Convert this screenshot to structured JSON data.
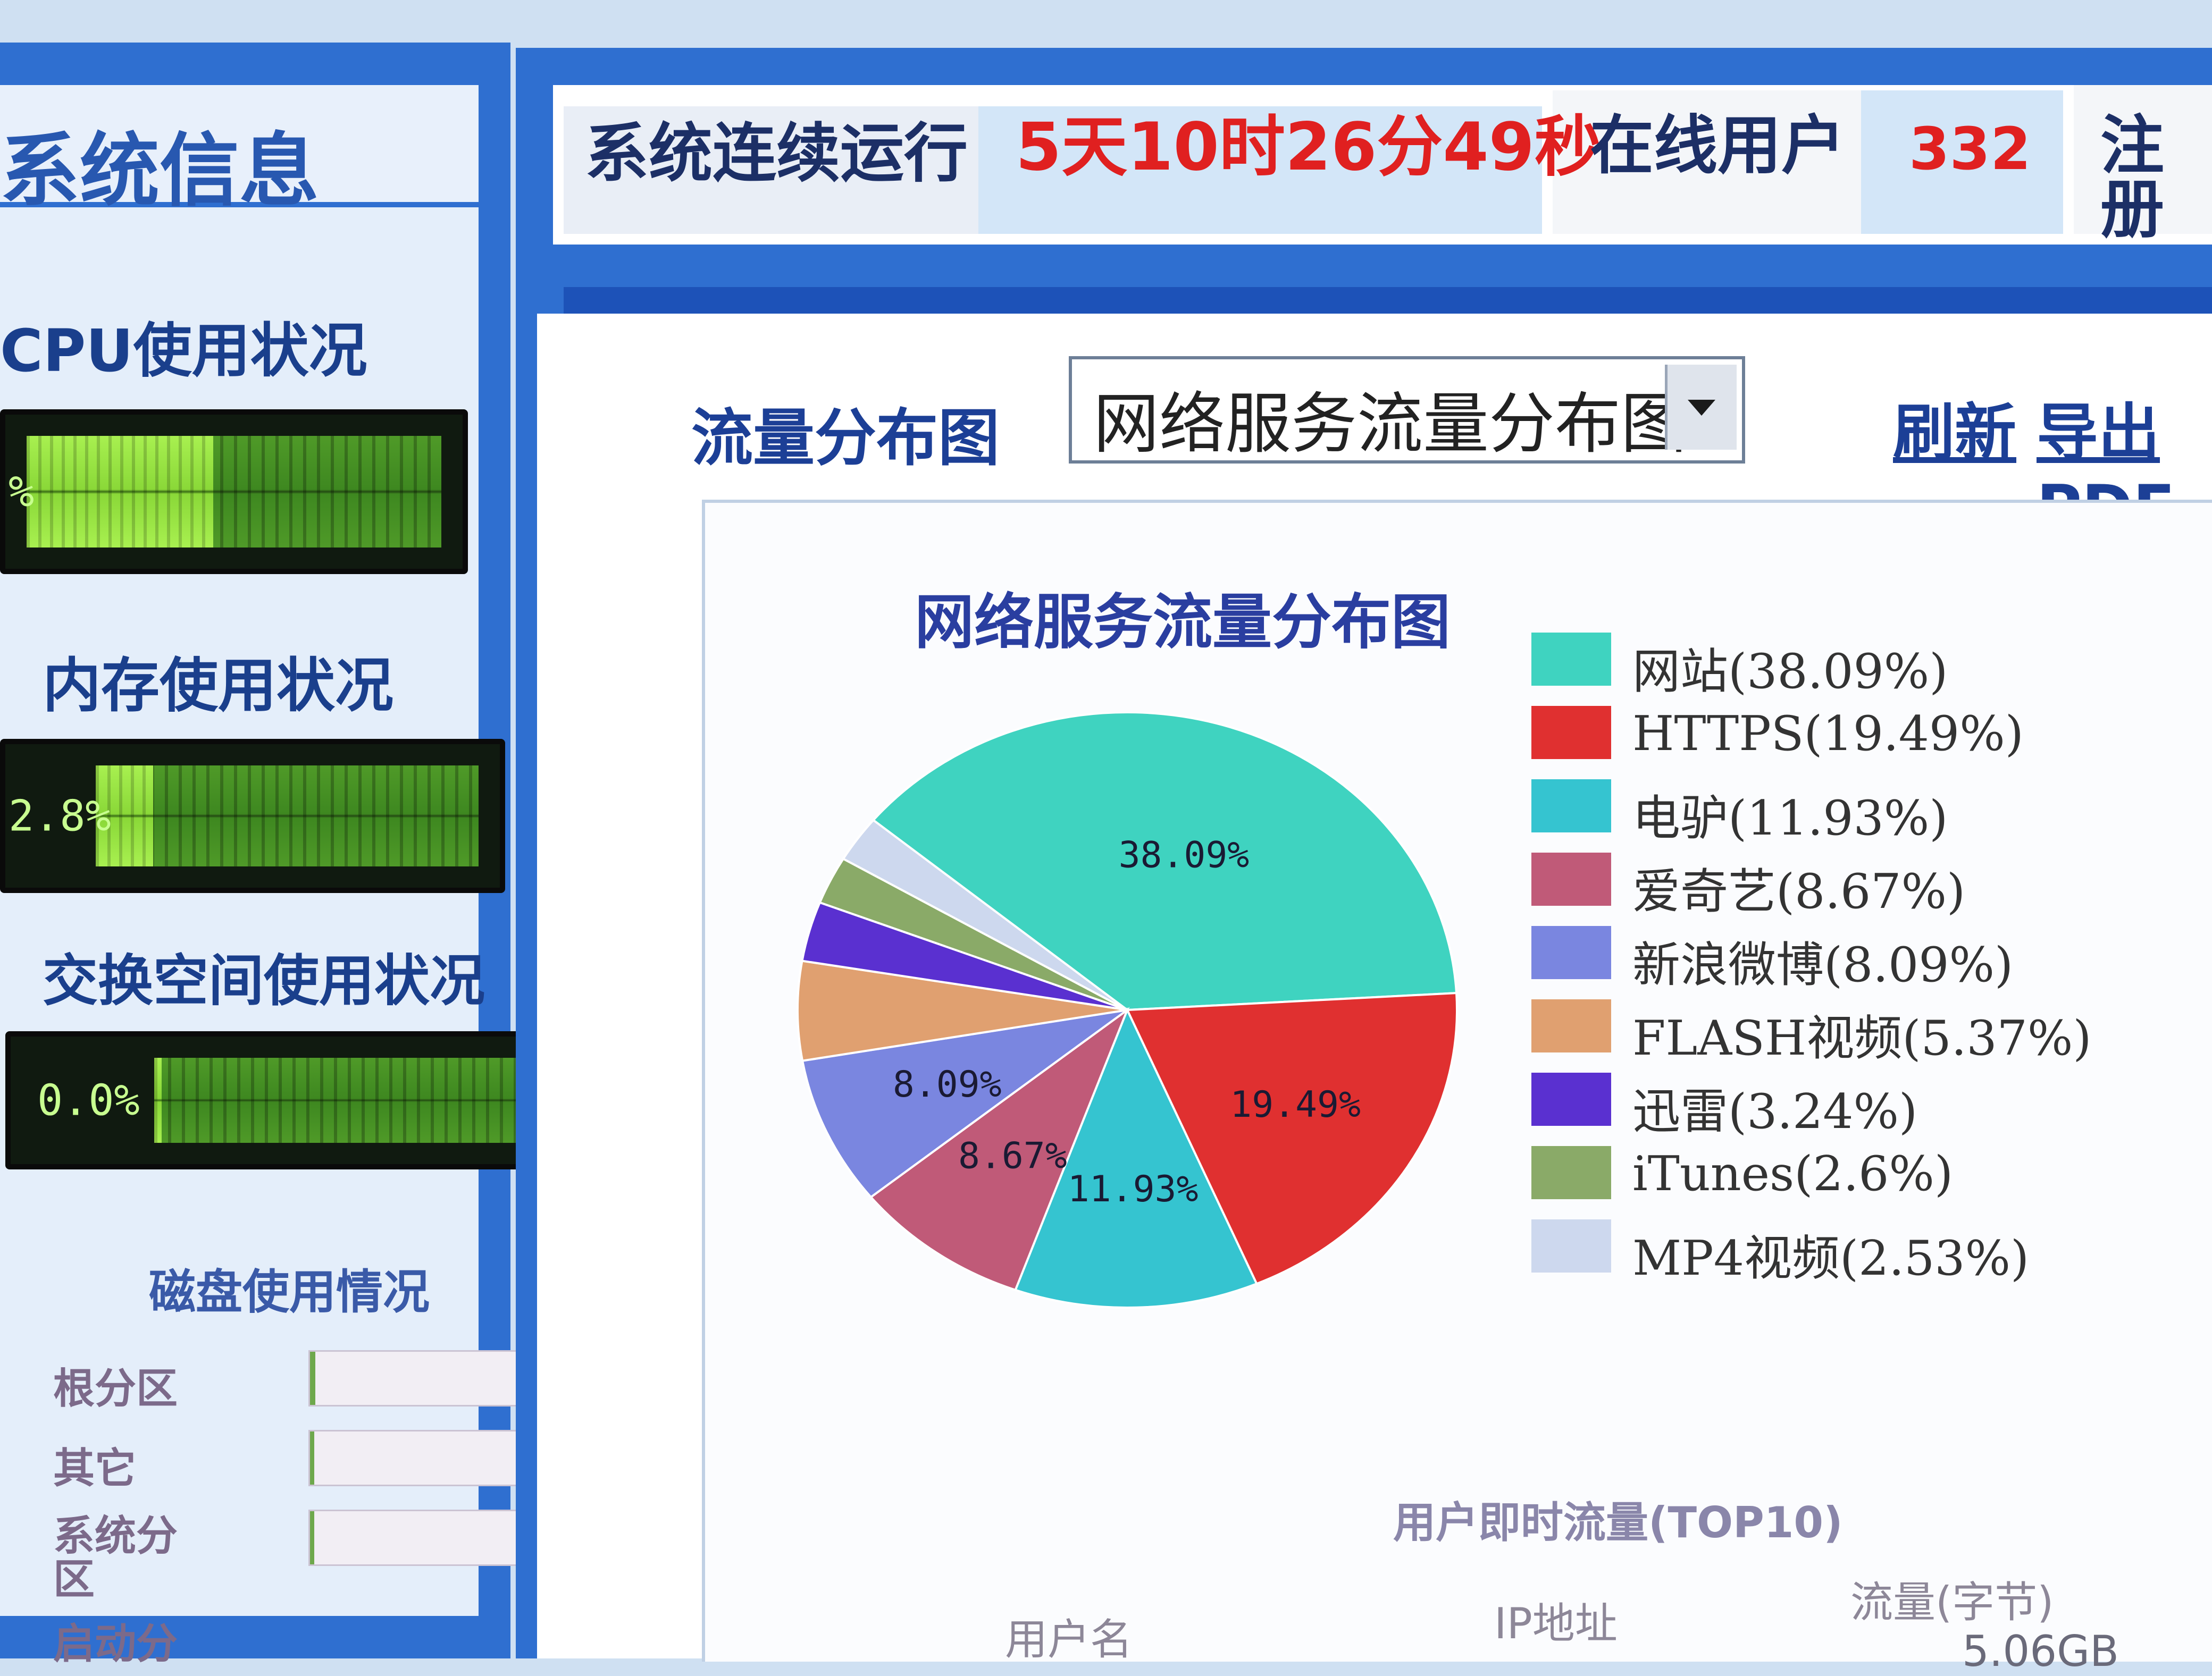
{
  "left": {
    "title": "系统信息",
    "cpu": {
      "heading": "CPU使用状况",
      "percent_text": "%",
      "fraction": 0.45
    },
    "memory": {
      "heading": "内存使用状况",
      "percent_text": "2.8%",
      "fraction": 0.15
    },
    "swap": {
      "heading": "交换空间使用状况",
      "percent_text": "0.0%",
      "fraction": 0.02
    },
    "disk": {
      "heading": "磁盘使用情况",
      "rows": [
        {
          "label": "根分区",
          "fraction": 0.02
        },
        {
          "label": "其它",
          "fraction": 0.01
        },
        {
          "label": "系统分区",
          "fraction": 0.0
        },
        {
          "label": "启动分",
          "fraction": 0.0
        }
      ]
    }
  },
  "top": {
    "running_label": "系统连续运行",
    "running_value": "5天10时26分49秒",
    "online_label": "在线用户",
    "online_value": "332",
    "next_label": "注册"
  },
  "chart_area": {
    "selector_label": "流量分布图",
    "selector_value": "网络服务流量分布图",
    "refresh_link": "刷新",
    "export_link": "导出PDF"
  },
  "chart_data": {
    "type": "pie",
    "title": "网络服务流量分布图",
    "slices": [
      {
        "label": "网站",
        "value": 38.09,
        "legend": "网站(38.09%)",
        "pct_label": "38.09%",
        "color": "#3fd3c0"
      },
      {
        "label": "HTTPS",
        "value": 19.49,
        "legend": "HTTPS(19.49%)",
        "pct_label": "19.49%",
        "color": "#e03030"
      },
      {
        "label": "电驴",
        "value": 11.93,
        "legend": "电驴(11.93%)",
        "pct_label": "11.93%",
        "color": "#35c4d0"
      },
      {
        "label": "爱奇艺",
        "value": 8.67,
        "legend": "爱奇艺(8.67%)",
        "pct_label": "8.67%",
        "color": "#c05a78"
      },
      {
        "label": "新浪微博",
        "value": 8.09,
        "legend": "新浪微博(8.09%)",
        "pct_label": "8.09%",
        "color": "#7a86e0"
      },
      {
        "label": "FLASH视频",
        "value": 5.37,
        "legend": "FLASH视频(5.37%)",
        "pct_label": "",
        "color": "#e0a070"
      },
      {
        "label": "迅雷",
        "value": 3.24,
        "legend": "迅雷(3.24%)",
        "pct_label": "",
        "color": "#5a30d0"
      },
      {
        "label": "iTunes",
        "value": 2.6,
        "legend": "iTunes(2.6%)",
        "pct_label": "",
        "color": "#8aaa68"
      },
      {
        "label": "MP4视频",
        "value": 2.53,
        "legend": "MP4视频(2.53%)",
        "pct_label": "",
        "color": "#cdd8ee"
      }
    ]
  },
  "bottom": {
    "title": "用户即时流量(TOP10)",
    "col_user": "用户名",
    "col_ip": "IP地址",
    "col_traffic": "流量(字节)",
    "first_traffic": "5.06GB"
  }
}
